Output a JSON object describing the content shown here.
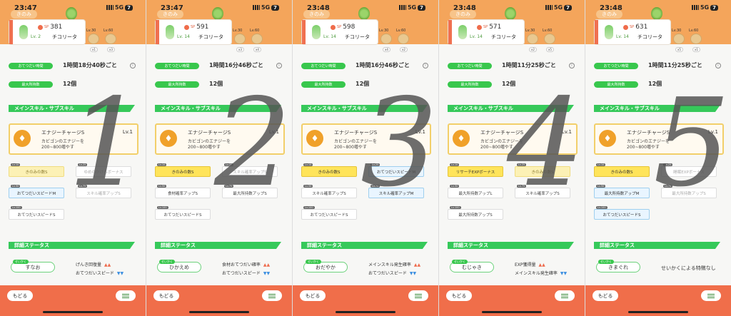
{
  "shared": {
    "tag_kinomi": "きのみ",
    "name": "チコリータ",
    "sp_label": "SP",
    "help_time_label": "おてつだい時間",
    "max_carry_label": "最大所持数",
    "max_carry_value": "12個",
    "skill_section": "メインスキル・サブスキル",
    "skill_name": "エナジーチャージS",
    "skill_level": "Lv.1",
    "skill_desc": "カビゴンのエナジーを200~800増やす",
    "detail_section": "詳細ステータス",
    "nature_tag": "せいかく",
    "back_label": "もどる",
    "signal": "5G",
    "battery": "7",
    "ing_levels": [
      "Lv.30",
      "Lv.60"
    ],
    "ing_counts": [
      "x1",
      "x3",
      "x4",
      "x2",
      "x5"
    ]
  },
  "panels": [
    {
      "time": "23:47",
      "sp": "381",
      "level": "Lv. 2",
      "help_time": "1時間18分40秒ごと",
      "digit": "1",
      "subs": [
        {
          "lv": "Lv.10",
          "label": "きのみの数S",
          "style": "pale"
        },
        {
          "lv": "Lv.25",
          "label": "ゆめのかけらボーナス",
          "style": "faded"
        },
        {
          "lv": "Lv.50",
          "label": "おてつだいスピードM",
          "style": "blue"
        },
        {
          "lv": "Lv.75",
          "label": "スキル確率アップS",
          "style": "faded"
        },
        {
          "lv": "Lv.100",
          "label": "おてつだいスピードS",
          "style": "plain"
        }
      ],
      "nature": "すなお",
      "effects": [
        {
          "label": "げんき回復量",
          "sign": "▲▲"
        },
        {
          "label": "おてつだいスピード",
          "sign": "▼▼"
        }
      ]
    },
    {
      "time": "23:47",
      "sp": "591",
      "level": "Lv. 14",
      "help_time": "1時間16分46秒ごと",
      "digit": "2",
      "subs": [
        {
          "lv": "Lv.10",
          "label": "きのみの数S",
          "style": "gold"
        },
        {
          "lv": "Lv.25",
          "label": "スキル確率アップS",
          "style": "faded"
        },
        {
          "lv": "Lv.50",
          "label": "食材確率アップS",
          "style": "plain"
        },
        {
          "lv": "Lv.75",
          "label": "最大所持数アップS",
          "style": "plain"
        },
        {
          "lv": "Lv.100",
          "label": "おてつだいスピードS",
          "style": "plain"
        }
      ],
      "nature": "ひかえめ",
      "effects": [
        {
          "label": "食材おてつだい確率",
          "sign": "▲▲"
        },
        {
          "label": "おてつだいスピード",
          "sign": "▼▼"
        }
      ]
    },
    {
      "time": "23:48",
      "sp": "598",
      "level": "Lv. 14",
      "help_time": "1時間16分46秒ごと",
      "digit": "3",
      "subs": [
        {
          "lv": "Lv.10",
          "label": "きのみの数S",
          "style": "gold"
        },
        {
          "lv": "Lv.25",
          "label": "おてつだいスピードM",
          "style": "blue"
        },
        {
          "lv": "Lv.50",
          "label": "スキル確率アップS",
          "style": "plain"
        },
        {
          "lv": "Lv.75",
          "label": "スキル確率アップM",
          "style": "blue"
        },
        {
          "lv": "Lv.100",
          "label": "おてつだいスピードS",
          "style": "plain"
        }
      ],
      "nature": "おだやか",
      "effects": [
        {
          "label": "メインスキル発生確率",
          "sign": "▲▲"
        },
        {
          "label": "おてつだいスピード",
          "sign": "▼▼"
        }
      ]
    },
    {
      "time": "23:48",
      "sp": "571",
      "level": "Lv. 14",
      "help_time": "1時間11分25秒ごと",
      "digit": "4",
      "subs": [
        {
          "lv": "Lv.10",
          "label": "リサーチEXPボーナス",
          "style": "gold"
        },
        {
          "lv": "Lv.25",
          "label": "きのみの数S",
          "style": "pale"
        },
        {
          "lv": "Lv.50",
          "label": "最大所持数アップL",
          "style": "plain"
        },
        {
          "lv": "Lv.75",
          "label": "スキル確率アップS",
          "style": "plain"
        },
        {
          "lv": "Lv.100",
          "label": "最大所持数アップS",
          "style": "plain"
        }
      ],
      "nature": "むじゃき",
      "effects": [
        {
          "label": "EXP獲得量",
          "sign": "▲▲"
        },
        {
          "label": "メインスキル発生確率",
          "sign": "▼▼"
        }
      ]
    },
    {
      "time": "23:48",
      "sp": "631",
      "level": "Lv. 14",
      "help_time": "1時間11分25秒ごと",
      "digit": "5",
      "subs": [
        {
          "lv": "Lv.10",
          "label": "きのみの数S",
          "style": "gold"
        },
        {
          "lv": "Lv.25",
          "label": "睡眠EXPボーナス",
          "style": "faded"
        },
        {
          "lv": "Lv.50",
          "label": "最大所持数アップM",
          "style": "blue"
        },
        {
          "lv": "Lv.75",
          "label": "最大所持数アップS",
          "style": "faded"
        },
        {
          "lv": "Lv.100",
          "label": "おてつだいスピードS",
          "style": "blue"
        }
      ],
      "nature": "きまぐれ",
      "effects": [],
      "effect_none": "せいかくによる特徴なし"
    }
  ]
}
